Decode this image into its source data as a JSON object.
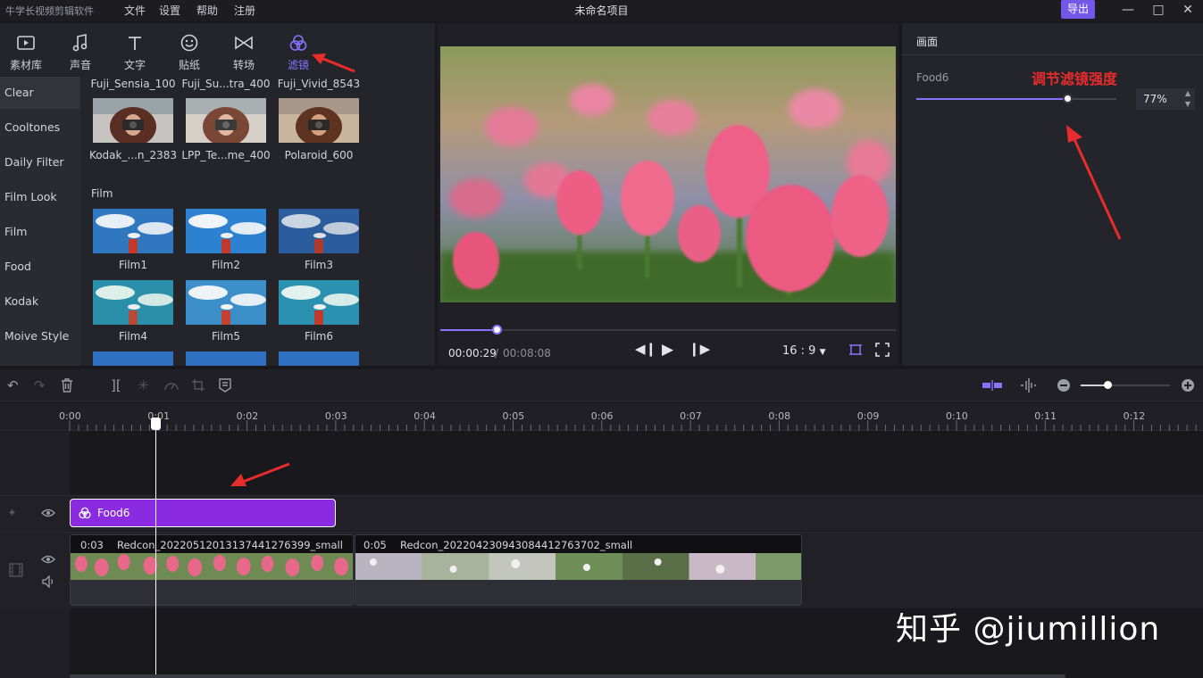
{
  "titlebar": {
    "app_name": "牛学长视频剪辑软件",
    "menus": [
      "文件",
      "设置",
      "帮助",
      "注册"
    ],
    "window_title": "未命名项目",
    "export_label": "导出",
    "controls": [
      "minimize-icon",
      "maximize-icon",
      "close-icon"
    ]
  },
  "toolbar": {
    "tabs": [
      {
        "label": "素材库",
        "icon": "media-icon"
      },
      {
        "label": "声音",
        "icon": "music-icon"
      },
      {
        "label": "文字",
        "icon": "text-icon"
      },
      {
        "label": "贴纸",
        "icon": "sticker-icon"
      },
      {
        "label": "转场",
        "icon": "transition-icon"
      },
      {
        "label": "滤镜",
        "icon": "filter-icon",
        "active": true
      }
    ]
  },
  "categories": [
    "Clear",
    "Cooltones",
    "Daily Filter",
    "Film Look",
    "Film",
    "Food",
    "Kodak",
    "Moive Style"
  ],
  "filters": {
    "top_row_labels": [
      "Fuji_Sensia_100",
      "Fuji_Su...tra_400",
      "Fuji_Vivid_8543"
    ],
    "row2_labels": [
      "Kodak_...n_2383",
      "LPP_Te...me_400",
      "Polaroid_600"
    ],
    "section_film": "Film",
    "film_row1": [
      "Film1",
      "Film2",
      "Film3"
    ],
    "film_row2": [
      "Film4",
      "Film5",
      "Film6"
    ]
  },
  "preview": {
    "time_current": "00:00:29",
    "time_separator": "/",
    "time_total": "00:08:08",
    "aspect_ratio": "16 : 9",
    "progress": 0.12
  },
  "properties": {
    "title": "画面",
    "filter_name": "Food6",
    "annotation": "调节滤镜强度",
    "strength_percent": "77%",
    "strength_value": 0.77
  },
  "timeline": {
    "ticks": [
      "0:00",
      "0:01",
      "0:02",
      "0:03",
      "0:04",
      "0:05",
      "0:06",
      "0:07",
      "0:08",
      "0:09",
      "0:10",
      "0:11",
      "0:12"
    ],
    "filter_clip": "Food6",
    "clips": [
      {
        "duration": "0:03",
        "name": "Redcon_20220512013137441276399_small"
      },
      {
        "duration": "0:05",
        "name": "Redcon_20220423094308441276370​2_small"
      }
    ]
  },
  "watermark": "知乎 @jiumillion",
  "colors": {
    "accent": "#8a72ff",
    "filter_clip": "#8a2be2",
    "annotation": "#e82c2c"
  }
}
